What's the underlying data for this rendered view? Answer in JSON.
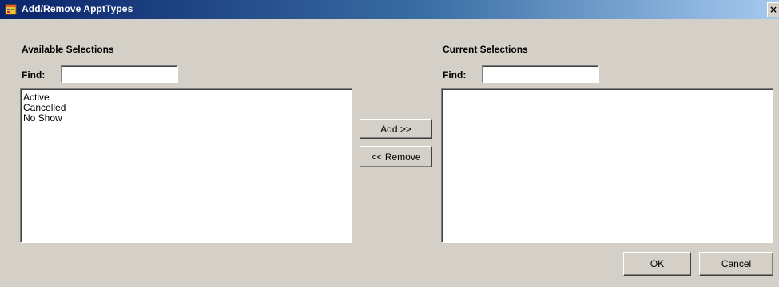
{
  "window": {
    "title": "Add/Remove ApptTypes",
    "close_glyph": "×"
  },
  "available": {
    "heading": "Available Selections",
    "find_label": "Find:",
    "find_value": "",
    "items": [
      "Active",
      "Cancelled",
      "No Show"
    ]
  },
  "current": {
    "heading": "Current Selections",
    "find_label": "Find:",
    "find_value": "",
    "items": []
  },
  "buttons": {
    "add": "Add >>",
    "remove": "<< Remove",
    "ok": "OK",
    "cancel": "Cancel"
  },
  "icons": {
    "title_icon": "application-icon",
    "close_icon": "close-icon"
  }
}
